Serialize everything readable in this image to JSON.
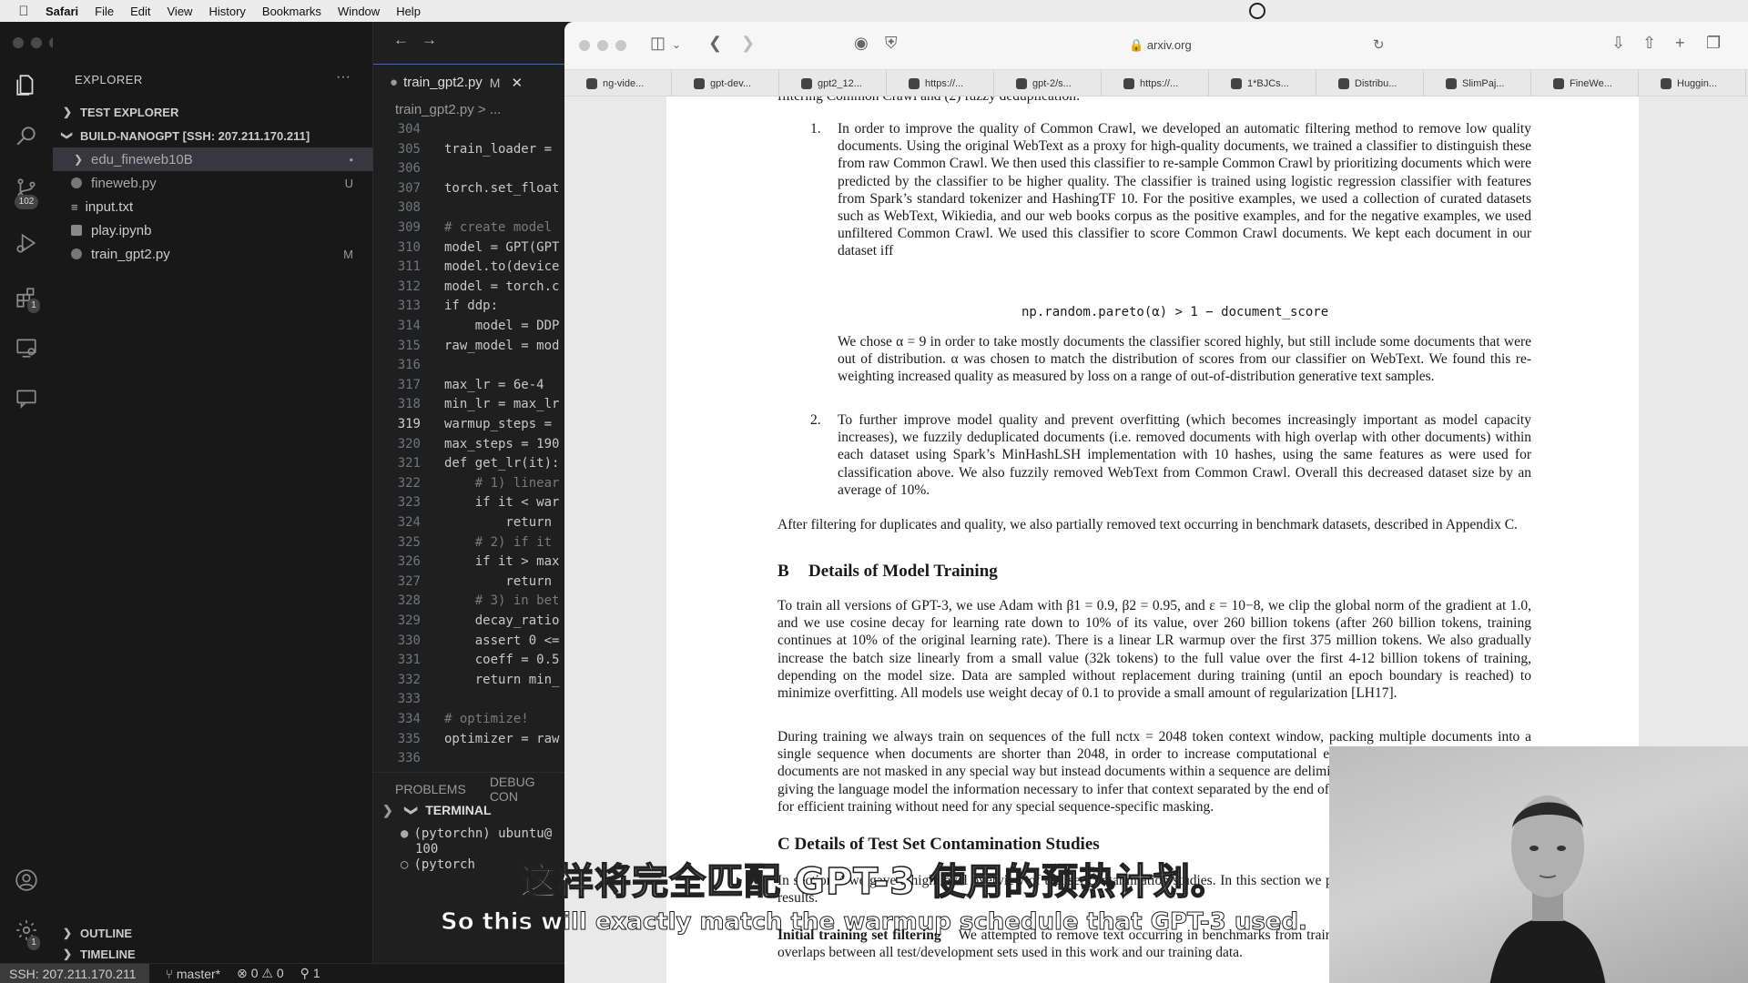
{
  "menubar": {
    "app": "Safari",
    "items": [
      "File",
      "Edit",
      "View",
      "History",
      "Bookmarks",
      "Window",
      "Help"
    ]
  },
  "vscode": {
    "explorer_title": "EXPLORER",
    "sections": {
      "test_explorer": "TEST EXPLORER",
      "project": "BUILD-NANOGPT [SSH: 207.211.170.211]",
      "outline": "OUTLINE",
      "timeline": "TIMELINE"
    },
    "files": [
      {
        "name": "edu_fineweb10B",
        "status": "•",
        "kind": "folder"
      },
      {
        "name": "fineweb.py",
        "status": "U",
        "kind": "py"
      },
      {
        "name": "input.txt",
        "status": "",
        "kind": "txt"
      },
      {
        "name": "play.ipynb",
        "status": "",
        "kind": "nb"
      },
      {
        "name": "train_gpt2.py",
        "status": "M",
        "kind": "py"
      }
    ],
    "badges": {
      "source_control": "102",
      "extensions": "1",
      "settings": "1"
    },
    "tab": {
      "name": "train_gpt2.py",
      "modified": "M"
    },
    "breadcrumb": "train_gpt2.py > ...",
    "code_lines": [
      {
        "no": "304",
        "text": ""
      },
      {
        "no": "305",
        "text": "train_loader = "
      },
      {
        "no": "306",
        "text": ""
      },
      {
        "no": "307",
        "text": "torch.set_float"
      },
      {
        "no": "308",
        "text": ""
      },
      {
        "no": "309",
        "text": "# create model"
      },
      {
        "no": "310",
        "text": "model = GPT(GPT"
      },
      {
        "no": "311",
        "text": "model.to(device"
      },
      {
        "no": "312",
        "text": "model = torch.c"
      },
      {
        "no": "313",
        "text": "if ddp:"
      },
      {
        "no": "314",
        "text": "    model = DDP"
      },
      {
        "no": "315",
        "text": "raw_model = mod"
      },
      {
        "no": "316",
        "text": ""
      },
      {
        "no": "317",
        "text": "max_lr = 6e-4"
      },
      {
        "no": "318",
        "text": "min_lr = max_lr"
      },
      {
        "no": "319",
        "text": "warmup_steps = "
      },
      {
        "no": "320",
        "text": "max_steps = 190"
      },
      {
        "no": "321",
        "text": "def get_lr(it):"
      },
      {
        "no": "322",
        "text": "    # 1) linear"
      },
      {
        "no": "323",
        "text": "    if it < war"
      },
      {
        "no": "324",
        "text": "        return "
      },
      {
        "no": "325",
        "text": "    # 2) if it "
      },
      {
        "no": "326",
        "text": "    if it > max"
      },
      {
        "no": "327",
        "text": "        return "
      },
      {
        "no": "328",
        "text": "    # 3) in bet"
      },
      {
        "no": "329",
        "text": "    decay_ratio"
      },
      {
        "no": "330",
        "text": "    assert 0 <="
      },
      {
        "no": "331",
        "text": "    coeff = 0.5"
      },
      {
        "no": "332",
        "text": "    return min_"
      },
      {
        "no": "333",
        "text": ""
      },
      {
        "no": "334",
        "text": "# optimize!"
      },
      {
        "no": "335",
        "text": "optimizer = raw"
      },
      {
        "no": "336",
        "text": ""
      }
    ],
    "panel_tabs": [
      "PROBLEMS",
      "DEBUG CON"
    ],
    "terminal_title": "TERMINAL",
    "terminal_lines": [
      "(pytorchn) ubuntu@",
      "100",
      "(pytorch"
    ],
    "status": {
      "remote": "SSH: 207.211.170.211",
      "branch": "master*",
      "problems": "⊗ 0 ⚠ 0",
      "ports": "1"
    }
  },
  "safari": {
    "url": "arxiv.org",
    "tabs": [
      "ng-vide...",
      "gpt-dev...",
      "gpt2_12...",
      "https://...",
      "gpt-2/s...",
      "https://...",
      "1*BJCs...",
      "Distribu...",
      "SlimPaj...",
      "FineWe...",
      "Huggin..."
    ],
    "paper": {
      "top_cut": "filtering Common Crawl and (2) fuzzy deduplication:",
      "item1_no": "1.",
      "item1": "In order to improve the quality of Common Crawl, we developed an automatic filtering method to remove low quality documents. Using the original WebText as a proxy for high-quality documents, we trained a classifier to distinguish these from raw Common Crawl. We then used this classifier to re-sample Common Crawl by prioritizing documents which were predicted by the classifier to be higher quality. The classifier is trained using logistic regression classifier with features from Spark’s standard tokenizer and HashingTF 10. For the positive examples, we used a collection of curated datasets such as WebText, Wikiedia, and our web books corpus as the positive examples, and for the negative examples, we used unfiltered Common Crawl. We used this classifier to score Common Crawl documents. We kept each document in our dataset iff",
      "equation": "np.random.pareto(α) > 1 − document_score",
      "item1_b": "We chose α = 9 in order to take mostly documents the classifier scored highly, but still include some documents that were out of distribution. α was chosen to match the distribution of scores from our classifier on WebText. We found this re-weighting increased quality as measured by loss on a range of out-of-distribution generative text samples.",
      "item2_no": "2.",
      "item2": "To further improve model quality and prevent overfitting (which becomes increasingly important as model capacity increases), we fuzzily deduplicated documents (i.e. removed documents with high overlap with other documents) within each dataset using Spark’s MinHashLSH implementation with 10 hashes, using the same features as were used for classification above. We also fuzzily removed WebText from Common Crawl. Overall this decreased dataset size by an average of 10%.",
      "after_filter": "After filtering for duplicates and quality, we also partially removed text occurring in benchmark datasets, described in Appendix C.",
      "section_b_no": "B",
      "section_b": "Details of Model Training",
      "training_p1": "To train all versions of GPT-3, we use Adam with β1 = 0.9, β2 = 0.95, and ε = 10−8, we clip the global norm of the gradient at 1.0, and we use cosine decay for learning rate down to 10% of its value, over 260 billion tokens (after 260 billion tokens, training continues at 10% of the original learning rate). There is a linear LR warmup over the first 375 million tokens. We also gradually increase the batch size linearly from a small value (32k tokens) to the full value over the first 4-12 billion tokens of training, depending on the model size. Data are sampled without replacement during training (until an epoch boundary is reached) to minimize overfitting. All models use weight decay of 0.1 to provide a small amount of regularization [LH17].",
      "training_p2": "During training we always train on sequences of the full nctx = 2048 token context window, packing multiple documents into a single sequence when documents are shorter than 2048, in order to increase computational efficiency. Sequences with multiple documents are not masked in any special way but instead documents within a sequence are delimited with a special end of text token, giving the language model the information necessary to infer that context separated by the end of text token is unrelated. This allows for efficient training without need for any special sequence-specific masking.",
      "section_c": "C   Details of Test Set Contamination Studies",
      "c_p1": "In section 4 we gave a high level overview of test set contamination studies. In this section we provide details on methodology and results.",
      "c_sub": "Initial training set filtering",
      "c_p2": "We attempted to remove text occurring in benchmarks from training data by searching for 13−gram overlaps between all test/development sets used in this work and our training data."
    }
  },
  "subtitles": {
    "zh": "这样将完全匹配 GPT-3 使用的预热计划。",
    "en": "So this will exactly match the warmup schedule that GPT-3 used."
  }
}
